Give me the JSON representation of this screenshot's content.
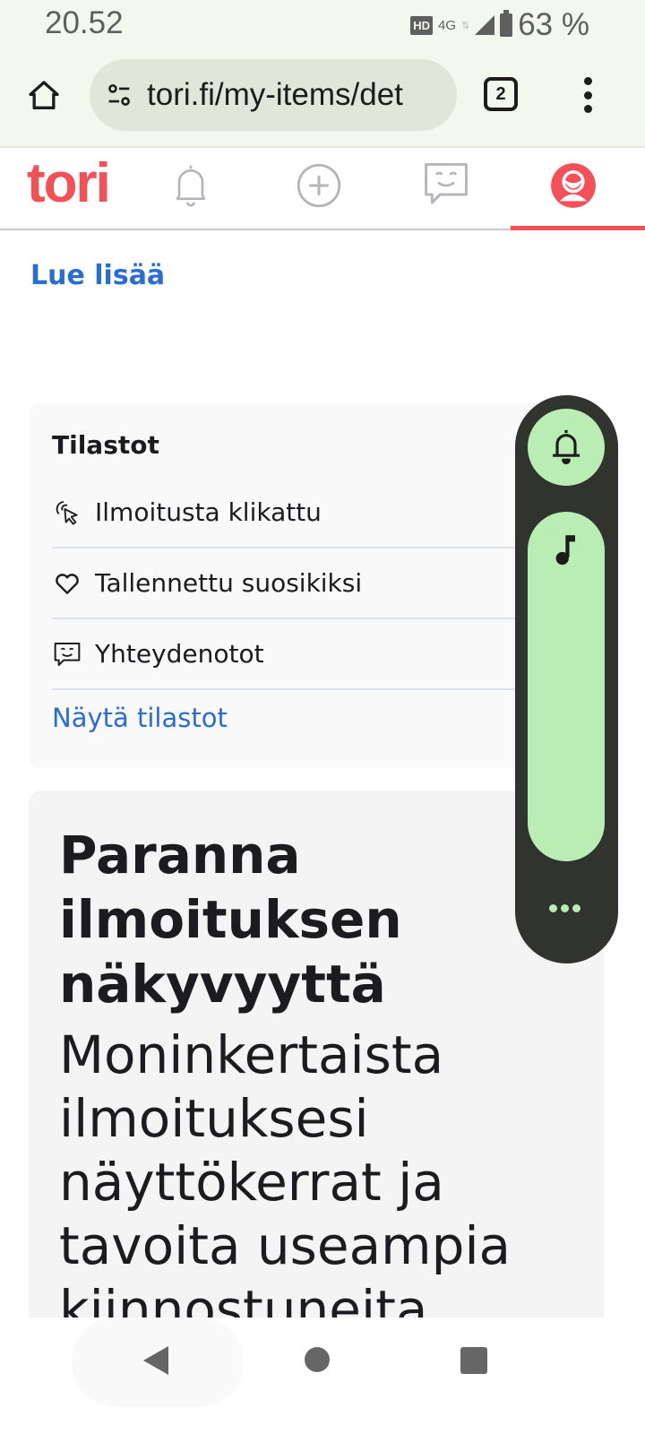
{
  "status_bar": {
    "time": "20.52",
    "hd_badge": "HD",
    "network": "4G",
    "network_arrows": "⇅",
    "battery_percent": "63 %"
  },
  "browser": {
    "url": "tori.fi/my-items/det",
    "tab_count": "2",
    "home_icon": "home-icon",
    "site_settings_icon": "tune-icon",
    "menu_icon": "more-vert-icon"
  },
  "site_nav": {
    "logo": "tori",
    "items": [
      {
        "icon": "bell-icon",
        "name": "notifications"
      },
      {
        "icon": "plus-circle-icon",
        "name": "new-listing"
      },
      {
        "icon": "chat-icon",
        "name": "messages"
      },
      {
        "icon": "profile-icon",
        "name": "profile",
        "active": true
      }
    ],
    "brand_color": "#f35157"
  },
  "content": {
    "read_more_link": "Lue lisää",
    "stats": {
      "title": "Tilastot",
      "rows": [
        {
          "icon": "click-cursor-icon",
          "label": "Ilmoitusta klikattu"
        },
        {
          "icon": "heart-icon",
          "label": "Tallennettu suosikiksi"
        },
        {
          "icon": "chat-smile-icon",
          "label": "Yhteydenotot"
        }
      ],
      "show_stats_link": "Näytä tilastot"
    },
    "promo": {
      "title": "Paranna ilmoituksen näkyvyyttä",
      "body": "Moninkertaista ilmoituksesi näyttökerrat ja tavoita useampia kiinnostuneita"
    },
    "link_color": "#2a6dd1"
  },
  "volume_panel": {
    "ringer_icon": "bell-icon",
    "media_icon": "music-note-icon",
    "more_icon": "more-horiz-icon",
    "media_volume_fraction": 1.0,
    "accent_color": "#b9edb4"
  },
  "system_nav": {
    "back": "back-icon",
    "home": "home-circle-icon",
    "recents": "recents-square-icon"
  }
}
